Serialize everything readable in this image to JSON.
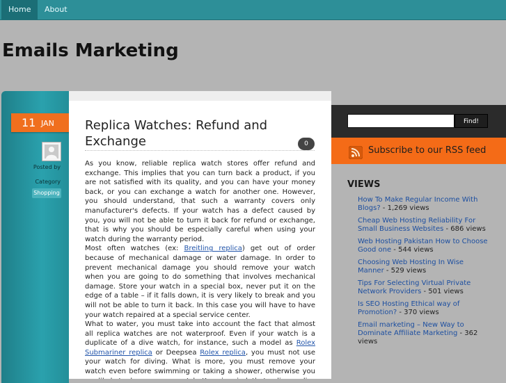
{
  "nav": {
    "items": [
      {
        "label": "Home"
      },
      {
        "label": "About"
      }
    ]
  },
  "site": {
    "title": "Emails Marketing"
  },
  "post": {
    "date_day": "11",
    "date_month": "JAN",
    "posted_by_label": "Posted by",
    "category_label": "Category",
    "category": "Shopping",
    "title": "Replica Watches: Refund and Exchange",
    "comment_count": "0",
    "para1": "As you know, reliable replica watch stores offer refund and exchange. This implies that you can turn back a product, if you are not satisfied with its quality, and you can have your money back, or you can exchange a watch for another one. However, you should understand, that such a warranty covers only manufacturer's defects. If your watch has a defect caused by you, you will not be able to turn it back for refund or exchange, that is why you should be especially careful when using your watch during the warranty period.",
    "para2_a": "Most often watches (ex: ",
    "link_breitling": "Breitling replica",
    "para2_b": ") get out of order because of mechanical damage or water damage. In order to prevent mechanical damage you should remove your watch when you are going to do something that involves mechanical damage. Store your watch in a special box, never put it on the edge of a table – if it falls down, it is very likely to break and you will not be able to turn it back. In this case you will have to have your watch repaired at a special service center.",
    "para3_a": "What to water, you must take into account the fact that almost all replica watches are not waterproof. Even if your watch is a duplicate of a dive watch, for instance, such a model as ",
    "link_rolex_sub": "Rolex Submariner replica",
    "para3_b": " or Deepsea ",
    "link_rolex": "Rolex replica",
    "para3_c": ", you must not use your watch for diving. What is more, you must remove your watch even before swimming or taking a shower, otherwise you are likely to damage your watch. Keep in mind, that online replica watch stores often have a"
  },
  "sidebar": {
    "search_placeholder": "",
    "find_label": "Find!",
    "rss_label": "Subscribe to our RSS feed",
    "views_title": "VIEWS",
    "views": [
      {
        "title": "How To Make Regular Income With Blogs?",
        "views": " - 1,269 views"
      },
      {
        "title": "Cheap Web Hosting Reliability For Small Business Websites",
        "views": " - 686 views"
      },
      {
        "title": "Web Hosting Pakistan How to Choose Good one",
        "views": " - 544 views"
      },
      {
        "title": "Choosing Web Hosting In Wise Manner",
        "views": " - 529 views"
      },
      {
        "title": "Tips For Selecting Virtual Private Network Providers",
        "views": " - 501 views"
      },
      {
        "title": "Is SEO Hosting Ethical way of Promotion?",
        "views": " - 370 views"
      },
      {
        "title": "Email marketing – New Way to Dominate Affiliate Marketing",
        "views": " - 362 views"
      }
    ]
  },
  "colors": {
    "nav_bg": "#2d8f98",
    "accent_orange": "#f46b17",
    "teal_column": "#2aa1ad",
    "link": "#1d4fa0"
  },
  "icons": {
    "avatar": "user-avatar-icon",
    "rss": "rss-icon"
  }
}
